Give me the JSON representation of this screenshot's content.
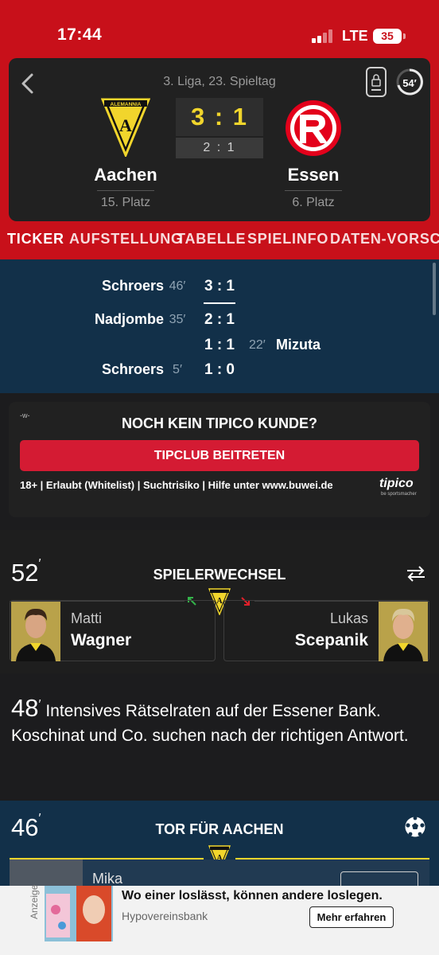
{
  "status_bar": {
    "time": "17:44",
    "network": "LTE",
    "battery": "35"
  },
  "match": {
    "league": "3. Liga, 23. Spieltag",
    "minute_badge": "54′",
    "home": {
      "name": "Aachen",
      "rank": "15. Platz",
      "crest_text": "ALEMANNIA",
      "crest_letter": "A"
    },
    "away": {
      "name": "Essen",
      "rank": "6. Platz"
    },
    "score": "3 : 1",
    "halftime_score": "2 : 1",
    "colors": {
      "red": "#c8101a",
      "yellow": "#f1d52c",
      "card_bg": "#212121",
      "navy": "#123049"
    }
  },
  "tabs": [
    {
      "label": "TICKER",
      "active": true
    },
    {
      "label": "AUFSTELLUNG"
    },
    {
      "label": "TABELLE"
    },
    {
      "label": "SPIELINFO"
    },
    {
      "label": "DATEN-VORSCHAU"
    }
  ],
  "goals": [
    {
      "name": "Schroers",
      "minute": "46′",
      "score": "3 : 1",
      "side": "home"
    },
    {
      "name": "Nadjombe",
      "minute": "35′",
      "score": "2 : 1",
      "side": "home"
    },
    {
      "name": "Mizuta",
      "minute": "22′",
      "score": "1 : 1",
      "side": "away"
    },
    {
      "name": "Schroers",
      "minute": "5′",
      "score": "1 : 0",
      "side": "home"
    }
  ],
  "tipico_ad": {
    "tag": "-w-",
    "title": "NOCH KEIN TIPICO KUNDE?",
    "button": "TIPCLUB BEITRETEN",
    "legal": "18+ | Erlaubt (Whitelist) | Suchtrisiko | Hilfe unter www.buwei.de",
    "logo": "tipico",
    "logo_sub": "be sportsmacher"
  },
  "substitution": {
    "minute": "52",
    "title": "SPIELERWECHSEL",
    "player_in": {
      "first": "Matti",
      "last": "Wagner"
    },
    "player_out": {
      "first": "Lukas",
      "last": "Scepanik"
    }
  },
  "text_entry": {
    "minute": "48",
    "text": "Intensives Rätselraten auf der Essener Bank. Koschinat und Co. suchen nach der richtigen Antwort."
  },
  "goal_event": {
    "minute": "46",
    "title": "TOR FÜR AACHEN",
    "player_first": "Mika"
  },
  "banner": {
    "tag": "Anzeige",
    "headline": "Wo einer loslässt, können andere loslegen.",
    "brand": "Hypovereinsbank",
    "button": "Mehr erfahren"
  }
}
